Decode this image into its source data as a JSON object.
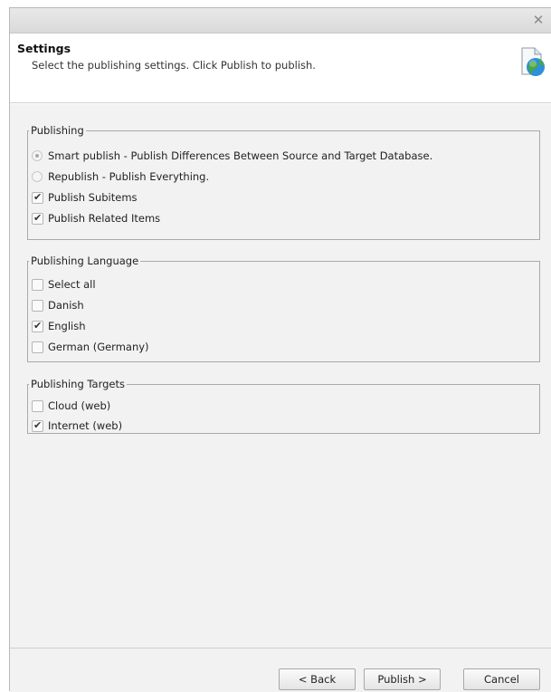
{
  "window": {
    "close_glyph": "✕"
  },
  "header": {
    "title": "Settings",
    "subtitle": "Select the publishing settings. Click Publish to publish.",
    "icon": "publish-globe-icon"
  },
  "publishing": {
    "legend": "Publishing",
    "options": [
      {
        "label": "Smart publish - Publish Differences Between Source and Target Database.",
        "type": "radio",
        "checked": true
      },
      {
        "label": "Republish - Publish Everything.",
        "type": "radio",
        "checked": false
      },
      {
        "label": "Publish Subitems",
        "type": "checkbox",
        "checked": true
      },
      {
        "label": "Publish Related Items",
        "type": "checkbox",
        "checked": true
      }
    ]
  },
  "languages": {
    "legend": "Publishing Language",
    "options": [
      {
        "label": "Select all",
        "checked": false
      },
      {
        "label": "Danish",
        "checked": false
      },
      {
        "label": "English",
        "checked": true
      },
      {
        "label": "German (Germany)",
        "checked": false
      }
    ]
  },
  "targets": {
    "legend": "Publishing Targets",
    "options": [
      {
        "label": "Cloud (web)",
        "checked": false
      },
      {
        "label": "Internet (web)",
        "checked": true
      }
    ]
  },
  "buttons": {
    "back": "< Back",
    "publish": "Publish >",
    "cancel": "Cancel"
  }
}
